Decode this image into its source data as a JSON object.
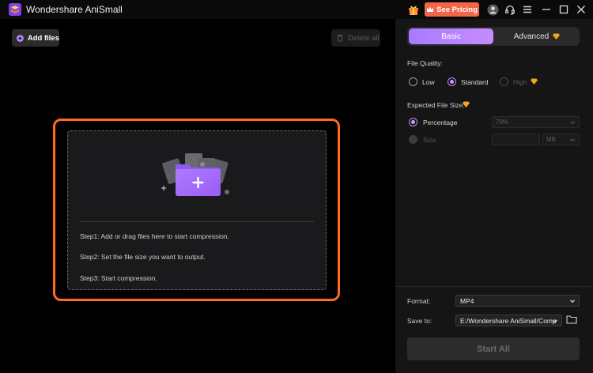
{
  "app": {
    "title": "Wondershare AniSmall",
    "pricing_label": "See Pricing"
  },
  "toolbar": {
    "add_files_label": "Add files",
    "delete_all_label": "Delete all"
  },
  "dropzone": {
    "steps": [
      "Step1: Add or drag files here to start compression.",
      "Step2: Set the file size you want to output.",
      "Step3: Start compression."
    ]
  },
  "settings": {
    "tabs": {
      "basic": "Basic",
      "advanced": "Advanced"
    },
    "file_quality": {
      "label": "File Quality:",
      "options": [
        "Low",
        "Standard",
        "High"
      ],
      "selected": "Standard"
    },
    "expected_size": {
      "label": "Expected File Size:",
      "percentage_label": "Percentage",
      "percentage_value": "70%",
      "size_label": "Size",
      "size_value": "",
      "size_unit": "MB"
    },
    "format": {
      "label": "Format:",
      "value": "MP4"
    },
    "save_to": {
      "label": "Save to:",
      "value": "E:/Wondershare AniSmall/Comp"
    },
    "start_label": "Start All"
  },
  "colors": {
    "accent_purple": "#b98cff",
    "dropzone_border": "#ff6a1f",
    "pricing_button": "#f4664a",
    "premium_gem": "#f6a21e"
  },
  "icons": [
    "app-logo-icon",
    "gift-icon",
    "crown-icon",
    "avatar-icon",
    "headset-icon",
    "menu-icon",
    "minimize-icon",
    "maximize-icon",
    "close-icon",
    "plus-circle-icon",
    "trash-icon",
    "folder-plus-icon",
    "gem-icon",
    "chevron-down-icon",
    "folder-icon"
  ]
}
